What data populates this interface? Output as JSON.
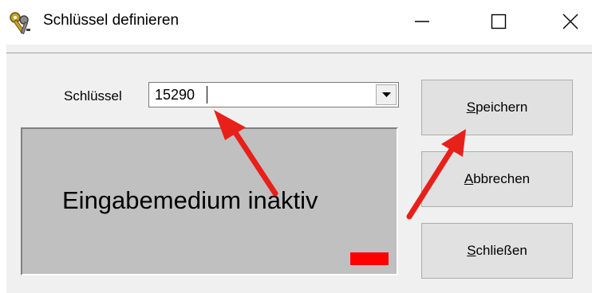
{
  "window": {
    "title": "Schlüssel definieren",
    "icon": "keys-icon",
    "controls": [
      "minimize-icon",
      "maximize-icon",
      "close-icon"
    ]
  },
  "form": {
    "key_label": "Schlüssel",
    "key_value": "15290"
  },
  "status_panel": {
    "text": "Eingabemedium inaktiv",
    "indicator_color": "#ff0000"
  },
  "buttons": {
    "save": "Speichern",
    "cancel": "Abbrechen",
    "close": "Schließen"
  },
  "annotations": {
    "arrow_color": "#e8201a"
  }
}
